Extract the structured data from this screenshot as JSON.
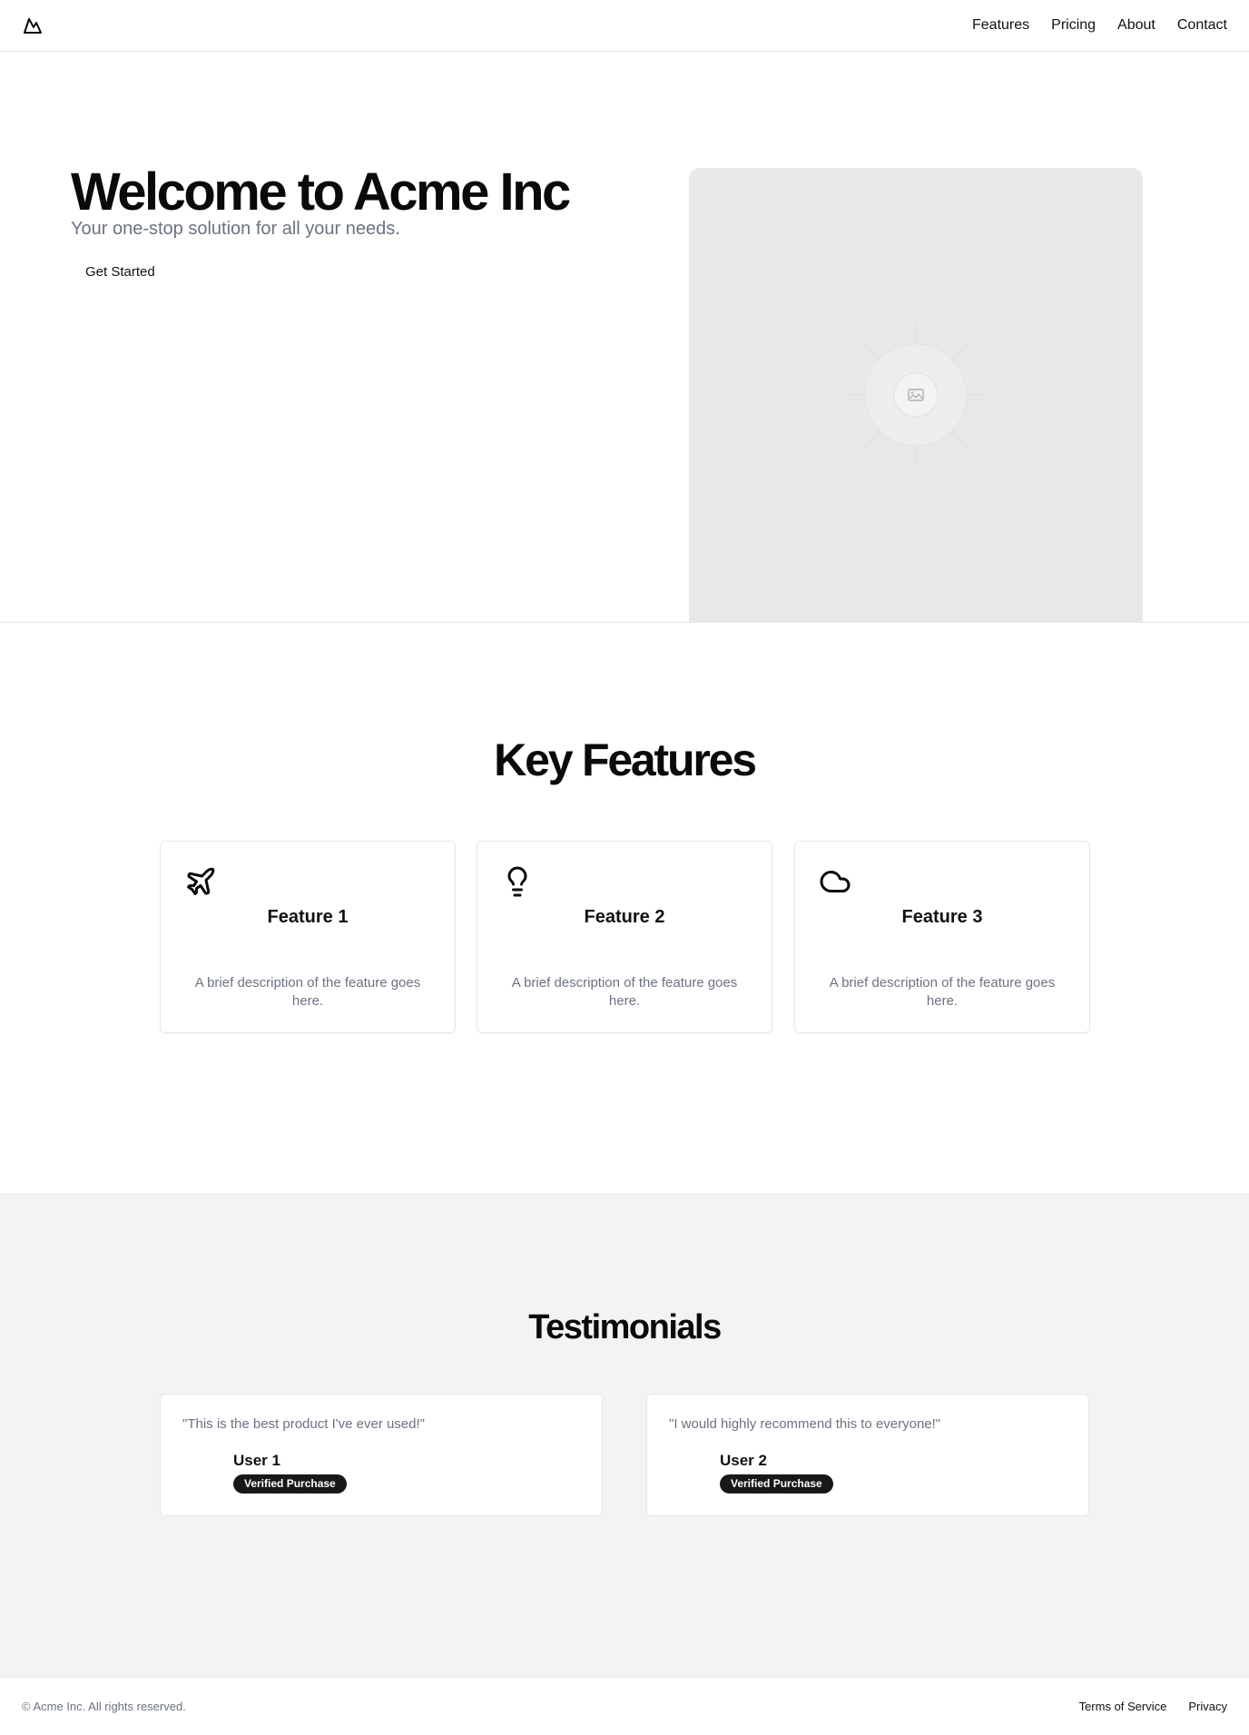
{
  "header": {
    "logo_icon": "mountain-icon",
    "nav": [
      "Features",
      "Pricing",
      "About",
      "Contact"
    ]
  },
  "hero": {
    "title": "Welcome to Acme Inc",
    "subtitle": "Your one-stop solution for all your needs.",
    "cta_label": "Get Started",
    "image_icon": "image-placeholder-icon"
  },
  "features": {
    "title": "Key Features",
    "items": [
      {
        "icon": "plane-icon",
        "title": "Feature 1",
        "description": "A brief description of the feature goes here."
      },
      {
        "icon": "lightbulb-icon",
        "title": "Feature 2",
        "description": "A brief description of the feature goes here."
      },
      {
        "icon": "cloud-icon",
        "title": "Feature 3",
        "description": "A brief description of the feature goes here."
      }
    ]
  },
  "testimonials": {
    "title": "Testimonials",
    "items": [
      {
        "quote": "\"This is the best product I've ever used!\"",
        "user": "User 1",
        "badge": "Verified Purchase"
      },
      {
        "quote": "\"I would highly recommend this to everyone!\"",
        "user": "User 2",
        "badge": "Verified Purchase"
      }
    ]
  },
  "footer": {
    "copyright": "© Acme Inc. All rights reserved.",
    "links": [
      "Terms of Service",
      "Privacy"
    ]
  },
  "colors": {
    "text": "#0a0a0a",
    "muted": "#6b7280",
    "border": "#e5e7eb",
    "section_bg": "#f2f3f5",
    "badge_bg": "#18181b",
    "image_bg": "#e8e8e8"
  }
}
